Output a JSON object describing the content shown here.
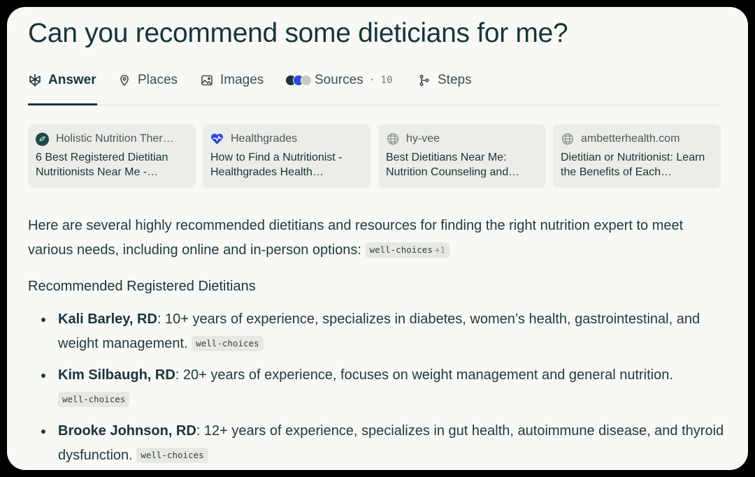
{
  "question": "Can you recommend some dieticians for me?",
  "tabs": [
    {
      "label": "Answer",
      "icon": "answer-icon",
      "active": true
    },
    {
      "label": "Places",
      "icon": "map-pin-icon"
    },
    {
      "label": "Images",
      "icon": "image-icon"
    },
    {
      "label": "Sources",
      "icon": "sources-icon",
      "count": "· 10"
    },
    {
      "label": "Steps",
      "icon": "steps-icon"
    }
  ],
  "source_cards": [
    {
      "source": "Holistic Nutrition Ther…",
      "title": "6 Best Registered Dietitian Nutritionists Near Me -…",
      "icon": "holistic-favicon"
    },
    {
      "source": "Healthgrades",
      "title": "How to Find a Nutritionist - Healthgrades Health…",
      "icon": "healthgrades-favicon"
    },
    {
      "source": "hy-vee",
      "title": "Best Dietitians Near Me: Nutrition Counseling and…",
      "icon": "globe-icon"
    },
    {
      "source": "ambetterhealth.com",
      "title": "Dietitian or Nutritionist: Learn the Benefits of Each…",
      "icon": "globe-icon"
    }
  ],
  "intro": {
    "text": "Here are several highly recommended dietitians and resources for finding the right nutrition expert to meet various needs, including online and in-person options:",
    "citation": "well-choices",
    "citation_extra": "+1"
  },
  "section_heading": "Recommended Registered Dietitians",
  "dietitians": [
    {
      "name": "Kali Barley, RD",
      "description": ": 10+ years of experience, specializes in diabetes, women’s health, gastrointestinal, and weight management.",
      "citation": "well-choices"
    },
    {
      "name": "Kim Silbaugh, RD",
      "description": ": 20+ years of experience, focuses on weight management and general nutrition.",
      "citation": "well-choices"
    },
    {
      "name": "Brooke Johnson, RD",
      "description": ": 12+ years of experience, specializes in gut health, autoimmune disease, and thyroid dysfunction.",
      "citation": "well-choices"
    }
  ],
  "colors": {
    "text_primary": "#17353b",
    "background": "#f8f8f5",
    "card_bg": "#ecece8",
    "healthgrades_blue": "#2b4ad8"
  }
}
